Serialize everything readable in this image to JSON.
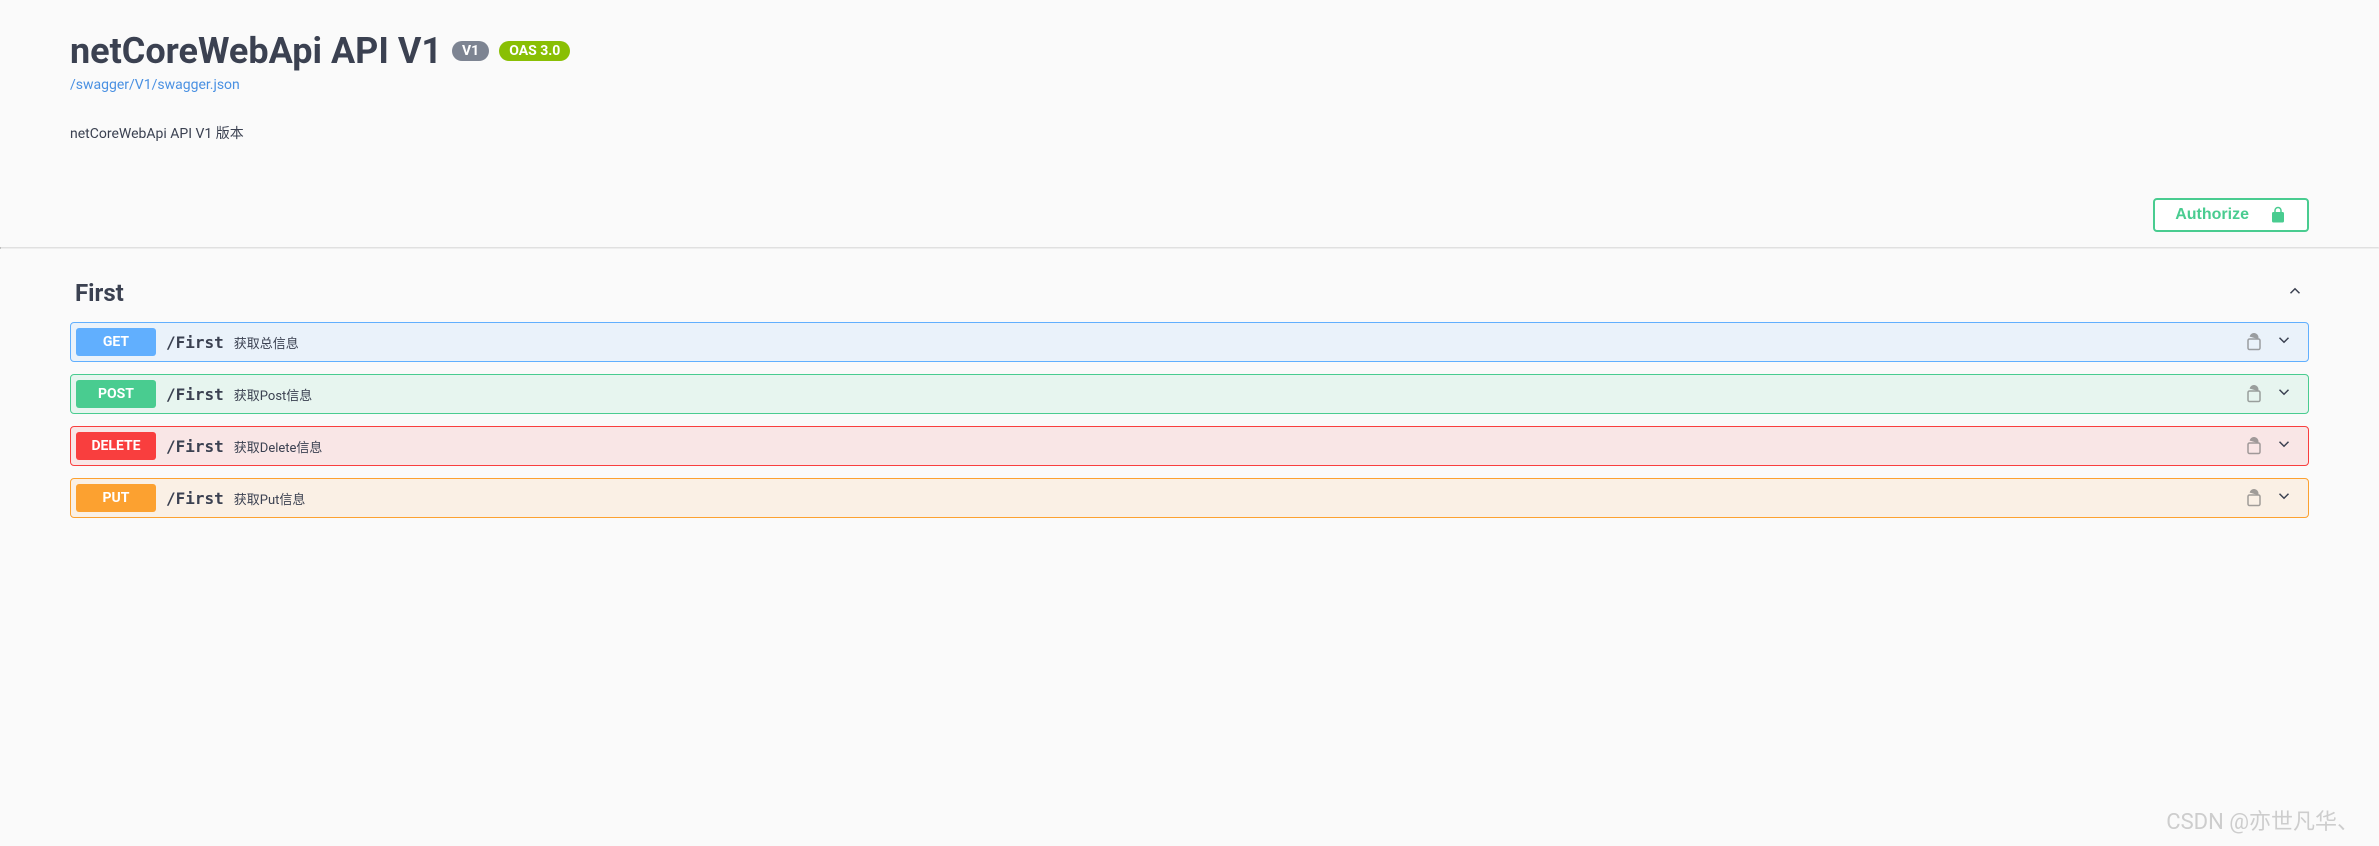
{
  "header": {
    "title": "netCoreWebApi API V1",
    "version_badge": "V1",
    "oas_badge": "OAS 3.0",
    "swagger_url": "/swagger/V1/swagger.json",
    "description": "netCoreWebApi API V1 版本"
  },
  "authorize": {
    "label": "Authorize"
  },
  "tag": {
    "name": "First"
  },
  "operations": [
    {
      "method": "GET",
      "method_class": "get",
      "path": "/First",
      "description": "获取总信息"
    },
    {
      "method": "POST",
      "method_class": "post",
      "path": "/First",
      "description": "获取Post信息"
    },
    {
      "method": "DELETE",
      "method_class": "delete",
      "path": "/First",
      "description": "获取Delete信息"
    },
    {
      "method": "PUT",
      "method_class": "put",
      "path": "/First",
      "description": "获取Put信息"
    }
  ],
  "watermark": "CSDN @亦世凡华、"
}
